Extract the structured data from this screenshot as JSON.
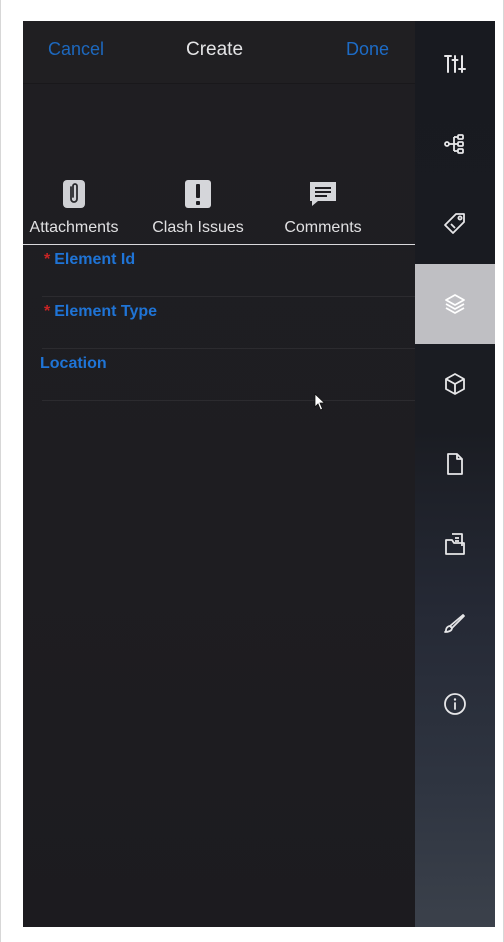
{
  "header": {
    "cancel_label": "Cancel",
    "title": "Create",
    "done_label": "Done",
    "accent_color": "#1d70cf"
  },
  "tabs": [
    {
      "label": "Attachments",
      "icon": "paperclip-icon"
    },
    {
      "label": "Clash Issues",
      "icon": "exclamation-icon"
    },
    {
      "label": "Comments",
      "icon": "comment-icon"
    }
  ],
  "fields": [
    {
      "label": "Element Id",
      "required": true
    },
    {
      "label": "Element Type",
      "required": true
    },
    {
      "label": "Location",
      "required": false
    }
  ],
  "required_marker": "*",
  "sidebar": {
    "items": [
      {
        "icon": "sliders-icon",
        "active": false
      },
      {
        "icon": "hierarchy-icon",
        "active": false
      },
      {
        "icon": "tag-icon",
        "active": false
      },
      {
        "icon": "layers-icon",
        "active": true
      },
      {
        "icon": "cube-icon",
        "active": false
      },
      {
        "icon": "document-icon",
        "active": false
      },
      {
        "icon": "folder-document-icon",
        "active": false
      },
      {
        "icon": "brush-icon",
        "active": false
      },
      {
        "icon": "info-icon",
        "active": false
      }
    ]
  },
  "colors": {
    "field_label": "#1f74d6",
    "required": "#c82424",
    "panel_bg": "#1f1e22",
    "sidebar_active": "#bfbfc3"
  }
}
